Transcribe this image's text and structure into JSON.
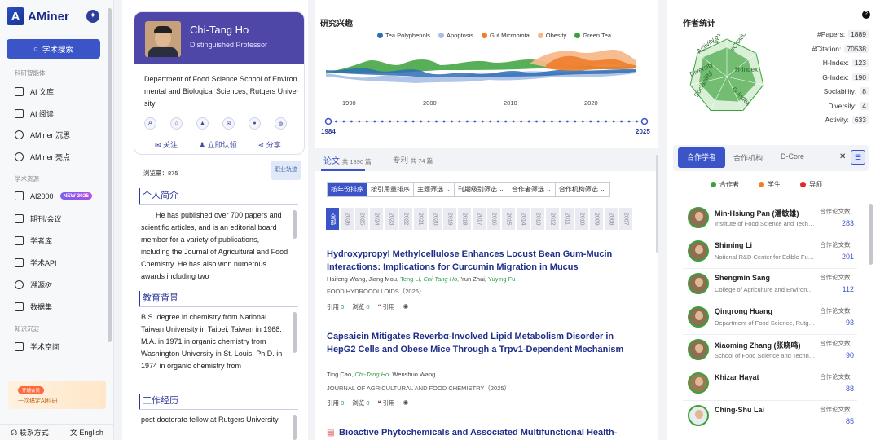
{
  "nav": {
    "logo": "AMiner",
    "search": "学术搜索",
    "section1": "科研智能体",
    "items1": [
      {
        "label": "AI 文库"
      },
      {
        "label": "AI 阅读"
      },
      {
        "label": "AMiner 沉思"
      },
      {
        "label": "AMiner 亮点"
      }
    ],
    "section2": "学术资源",
    "items2": [
      {
        "label": "AI2000",
        "badge": "NEW 2025"
      },
      {
        "label": "期刊/会议"
      },
      {
        "label": "学者库"
      },
      {
        "label": "学术API"
      },
      {
        "label": "溯源树"
      },
      {
        "label": "数据集"
      }
    ],
    "section3": "知识沉淀",
    "items3": [
      {
        "label": "学术空间"
      }
    ],
    "promo_tag": "开通会员",
    "promo_text": "一次搞定AI科研",
    "contact": "联系方式",
    "language": "English"
  },
  "profile": {
    "name": "Chi-Tang Ho",
    "title": "Distinguished Professor",
    "affiliation": "Department of Food Science School of Environmental and Biological Sciences, Rutgers University",
    "follow": "关注",
    "claim": "立即认领",
    "share": "分享",
    "views_label": "浏览量：",
    "views": "875",
    "map_label": "职业轨迹",
    "bio_title": "个人简介",
    "bio": "He has published over 700 papers and scientific articles, and is an editorial board member for a variety of publications, including the Journal of Agricultural and Food Chemistry. He has also won numerous awards including two",
    "edu_title": "教育背景",
    "edu": "B.S. degree in chemistry from National Taiwan University in Taipei, Taiwan in 1968. M.A. in 1971 in organic chemistry from Washington University in St. Louis. Ph.D. in 1974 in organic chemistry from",
    "work_title": "工作经历",
    "work": "post doctorate fellow at Rutgers University"
  },
  "interests": {
    "title": "研究兴趣",
    "legend": [
      {
        "name": "Tea Polyphenols",
        "color": "#2f6db5"
      },
      {
        "name": "Apoptosis",
        "color": "#a9bfe6"
      },
      {
        "name": "Gut Microbiota",
        "color": "#f07d2a"
      },
      {
        "name": "Obesity",
        "color": "#f7b98a"
      },
      {
        "name": "Green Tea",
        "color": "#3aa23a"
      }
    ],
    "years": [
      "1990",
      "2000",
      "2010",
      "2020"
    ],
    "timeline_start": "1984",
    "timeline_end": "2025"
  },
  "papers": {
    "tab_papers": "论文",
    "papers_count": "共 1890 篇",
    "tab_patents": "专利",
    "patents_count": "共 74 篇",
    "sorts": [
      "按年份排序",
      "按引用量排序",
      "主题筛选 ⌄",
      "刊期级别筛选 ⌄",
      "合作者筛选 ⌄",
      "合作机构筛选 ⌄"
    ],
    "year_all": "全部",
    "years": [
      "2026",
      "2025",
      "2024",
      "2023",
      "2022",
      "2021",
      "2020",
      "2019",
      "2018",
      "2017",
      "2016",
      "2015",
      "2014",
      "2013",
      "2012",
      "2011",
      "2010",
      "2009",
      "2008",
      "2007"
    ],
    "cite_label": "引用",
    "view_label": "浏览",
    "quote_label": "引用",
    "list": [
      {
        "title": "Hydroxypropyl Methylcellulose Enhances Locust Bean Gum-Mucin Interactions: Implications for Curcumin Migration in Mucus",
        "authors_a": "Haifeng Wang,  Jiang Mou,",
        "authors_b": "Teng Li,",
        "authors_c": "Chi-Tang Ho,",
        "authors_d": "Yun Zhai,",
        "authors_e": "Yuying Fu",
        "venue": "FOOD HYDROCOLLOIDS（2026）",
        "cites": "0",
        "views": "0"
      },
      {
        "title": "Capsaicin Mitigates Reverbα-Involved Lipid Metabolism Disorder in HepG2 Cells and Obese Mice Through a Trpv1-Dependent Mechanism",
        "authors_a": "Ting Cao,",
        "authors_c": "Chi-Tang Ho,",
        "authors_d": "Wenshuo Wang",
        "venue": "JOURNAL OF AGRICULTURAL AND FOOD CHEMISTRY（2025）",
        "cites": "0",
        "views": "0"
      },
      {
        "title": "Bioactive Phytochemicals and Associated Multifunctional Health-"
      }
    ]
  },
  "stats": {
    "title": "作者统计",
    "radar_labels": [
      "#Papers",
      "#Citation",
      "H-Index",
      "G-Index",
      "Sociability",
      "Diversity",
      "Activity"
    ],
    "rows": [
      {
        "label": "#Papers:",
        "value": "1889"
      },
      {
        "label": "#Citation:",
        "value": "70538"
      },
      {
        "label": "H-Index:",
        "value": "123"
      },
      {
        "label": "G-Index:",
        "value": "190"
      },
      {
        "label": "Sociability:",
        "value": "8"
      },
      {
        "label": "Diversity:",
        "value": "4"
      },
      {
        "label": "Activity:",
        "value": "633"
      }
    ]
  },
  "coauthors": {
    "tab_coauthors": "合作学者",
    "tab_orgs": "合作机构",
    "tab_dcore": "D-Core",
    "legend": [
      {
        "label": "合作者",
        "color": "#3aa23a"
      },
      {
        "label": "学生",
        "color": "#f07d2a"
      },
      {
        "label": "导师",
        "color": "#e02828"
      }
    ],
    "count_label": "合作论文数",
    "list": [
      {
        "name": "Min-Hsiung Pan (潘敏雄)",
        "org": "Institute of Food Science and Technology",
        "count": "283"
      },
      {
        "name": "Shiming Li",
        "org": "National R&D Center for Edible Fungus",
        "count": "201"
      },
      {
        "name": "Shengmin Sang",
        "org": "College of Agriculture and Environmental",
        "count": "112"
      },
      {
        "name": "Qingrong Huang",
        "org": "Department of Food Science, Rutgers",
        "count": "93"
      },
      {
        "name": "Xiaoming Zhang (张晓鸣)",
        "org": "School of Food Science and Technology",
        "count": "90"
      },
      {
        "name": "Khizar Hayat",
        "org": "",
        "count": "88"
      },
      {
        "name": "Ching-Shu Lai",
        "org": "",
        "count": "85"
      }
    ]
  }
}
